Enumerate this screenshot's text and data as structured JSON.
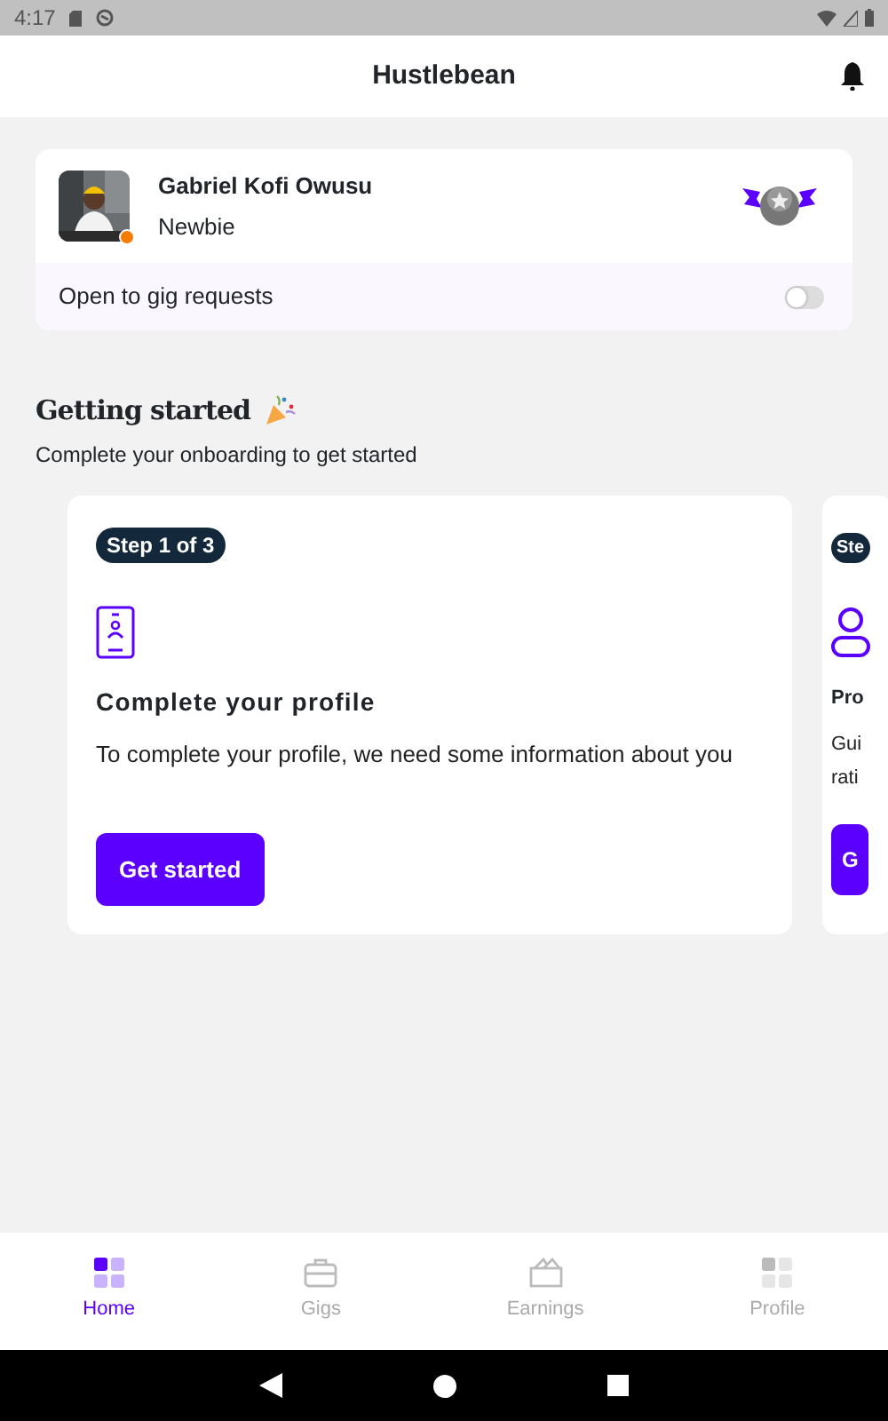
{
  "status_bar": {
    "time": "4:17"
  },
  "app_bar": {
    "title": "Hustlebean"
  },
  "profile": {
    "name": "Gabriel Kofi Owusu",
    "level": "Newbie",
    "gig_requests": {
      "label": "Open to gig requests",
      "on": false
    }
  },
  "onboarding": {
    "title": "Getting started",
    "subtitle": "Complete your onboarding to get started",
    "steps": [
      {
        "step": "Step 1 of 3",
        "title": "Complete your profile",
        "description": "To complete your profile, we need some information about you",
        "button": "Get started"
      },
      {
        "step": "Ste",
        "title": "Pro",
        "description": "Gui rati",
        "button": "G"
      }
    ]
  },
  "bottom_nav": [
    {
      "label": "Home",
      "selected": true
    },
    {
      "label": "Gigs",
      "selected": false
    },
    {
      "label": "Earnings",
      "selected": false
    },
    {
      "label": "Profile",
      "selected": false
    }
  ]
}
